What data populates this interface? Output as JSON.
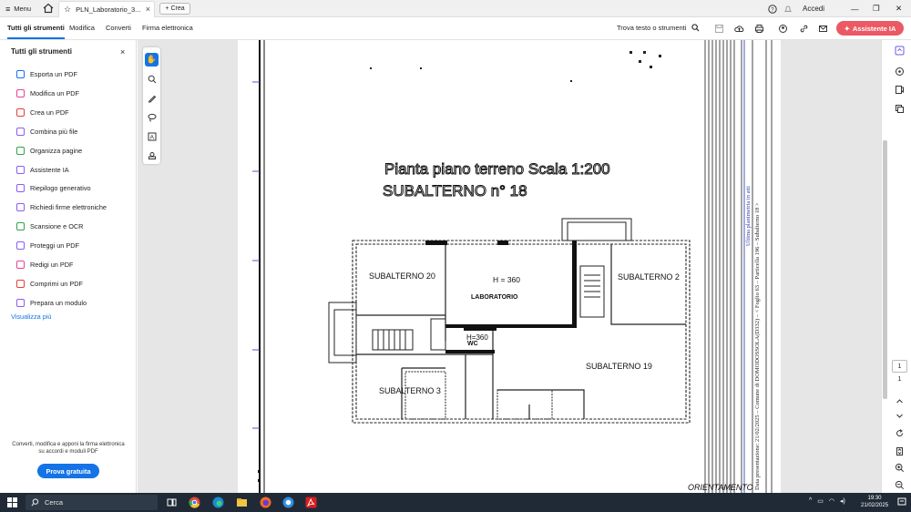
{
  "titlebar": {
    "menu_label": "Menu",
    "tab_title": "PLN_Laboratorio_3...",
    "tab_close": "×",
    "new_tab_label": "Crea",
    "login_label": "Accedi",
    "win_minimize": "—",
    "win_restore": "❐",
    "win_close": "✕"
  },
  "menubar": {
    "tabs": [
      {
        "label": "Tutti gli strumenti"
      },
      {
        "label": "Modifica"
      },
      {
        "label": "Converti"
      },
      {
        "label": "Firma elettronica"
      }
    ],
    "search_label": "Trova testo o strumenti",
    "ai_label": "Assistente IA"
  },
  "sidebar": {
    "title": "Tutti gli strumenti",
    "close": "×",
    "items": [
      {
        "label": "Esporta un PDF",
        "icon": "export-pdf-icon",
        "color": "#1473e6"
      },
      {
        "label": "Modifica un PDF",
        "icon": "edit-pdf-icon",
        "color": "#e34598"
      },
      {
        "label": "Crea un PDF",
        "icon": "create-pdf-icon",
        "color": "#e3403b"
      },
      {
        "label": "Combina più file",
        "icon": "combine-files-icon",
        "color": "#8b5cf6"
      },
      {
        "label": "Organizza pagine",
        "icon": "organize-pages-icon",
        "color": "#2da44e"
      },
      {
        "label": "Assistente IA",
        "icon": "ai-assistant-icon",
        "color": "#8b5cf6"
      },
      {
        "label": "Riepilogo generativo",
        "icon": "generative-summary-icon",
        "color": "#8b5cf6"
      },
      {
        "label": "Richiedi firme elettroniche",
        "icon": "request-esign-icon",
        "color": "#8b5cf6"
      },
      {
        "label": "Scansione e OCR",
        "icon": "scan-ocr-icon",
        "color": "#2da44e"
      },
      {
        "label": "Proteggi un PDF",
        "icon": "protect-pdf-icon",
        "color": "#8b5cf6"
      },
      {
        "label": "Redigi un PDF",
        "icon": "redact-pdf-icon",
        "color": "#e34598"
      },
      {
        "label": "Comprimi un PDF",
        "icon": "compress-pdf-icon",
        "color": "#e3403b"
      },
      {
        "label": "Prepara un modulo",
        "icon": "prepare-form-icon",
        "color": "#8b5cf6"
      }
    ],
    "more_label": "Visualizza più",
    "promo_text": "Converti, modifica e apponi la firma elettronica su accordi e moduli PDF",
    "trial_label": "Prova gratuita"
  },
  "drawing": {
    "title1": "Pianta piano terreno Scala 1:200",
    "title2": "SUBALTERNO n° 18",
    "rooms": [
      "SUBALTERNO 20",
      "H = 360",
      "LABORATORIO",
      "SUBALTERNO 2",
      "H=360",
      "WC",
      "SUBALTERNO 19",
      "SUBALTERNO 3"
    ],
    "orientation": "ORIENTAMENTO",
    "side_text_a": "Data presentazione: 21/02/2025 – Comune di DOMODOSSOLA(D332) – < Foglio 63 – Particella 196 – Subalterno 18 >",
    "side_text_b": "Ultima planimetria in atti"
  },
  "viewer": {
    "page_current": "1",
    "page_total": "1"
  },
  "taskbar": {
    "search_placeholder": "Cerca",
    "time": "19:30",
    "date": "21/02/2025"
  },
  "colors": {
    "accent": "#1473e6",
    "ai": "#eb5a64",
    "taskbar": "#202a36"
  }
}
